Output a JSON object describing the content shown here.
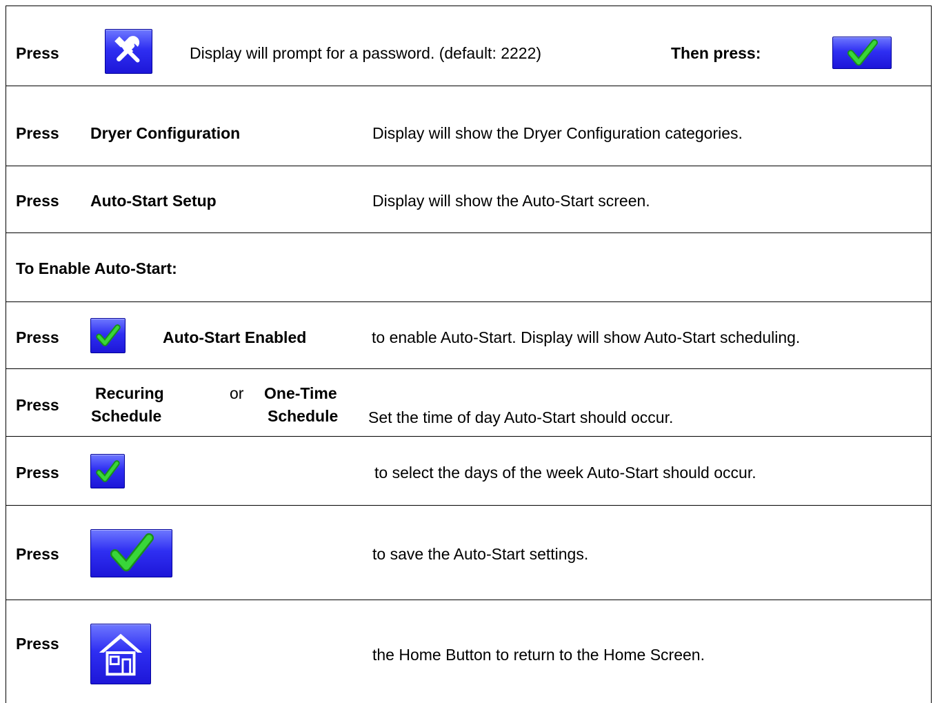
{
  "rows": [
    {
      "press": "Press",
      "text": "Display will prompt for a password. (default: 2222)",
      "then": "Then press:"
    },
    {
      "press": "Press",
      "label": "Dryer Configuration",
      "text": "Display will show the Dryer Configuration categories."
    },
    {
      "press": "Press",
      "label": "Auto-Start Setup",
      "text": "Display will show the Auto-Start screen."
    },
    {
      "heading": "To Enable Auto-Start:"
    },
    {
      "press": "Press",
      "label": "Auto-Start Enabled",
      "text": "to enable Auto-Start.  Display will show Auto-Start scheduling."
    },
    {
      "press": "Press",
      "opt1_line1": "Recuring",
      "opt1_line2": "Schedule",
      "or": "or",
      "opt2_line1": "One-Time",
      "opt2_line2": "Schedule",
      "text": "Set the time of day Auto-Start should occur."
    },
    {
      "press": "Press",
      "text": "to select the days of the week Auto-Start should occur."
    },
    {
      "press": "Press",
      "text": "to save the Auto-Start settings."
    },
    {
      "press": "Press",
      "text": "the Home Button to return to the Home Screen."
    }
  ],
  "icons": {
    "tools": "tools-icon",
    "check": "checkmark-icon",
    "home": "home-icon"
  },
  "colors": {
    "button_blue": "#2f2ff2",
    "check_green": "#22b122",
    "border": "#000000"
  }
}
